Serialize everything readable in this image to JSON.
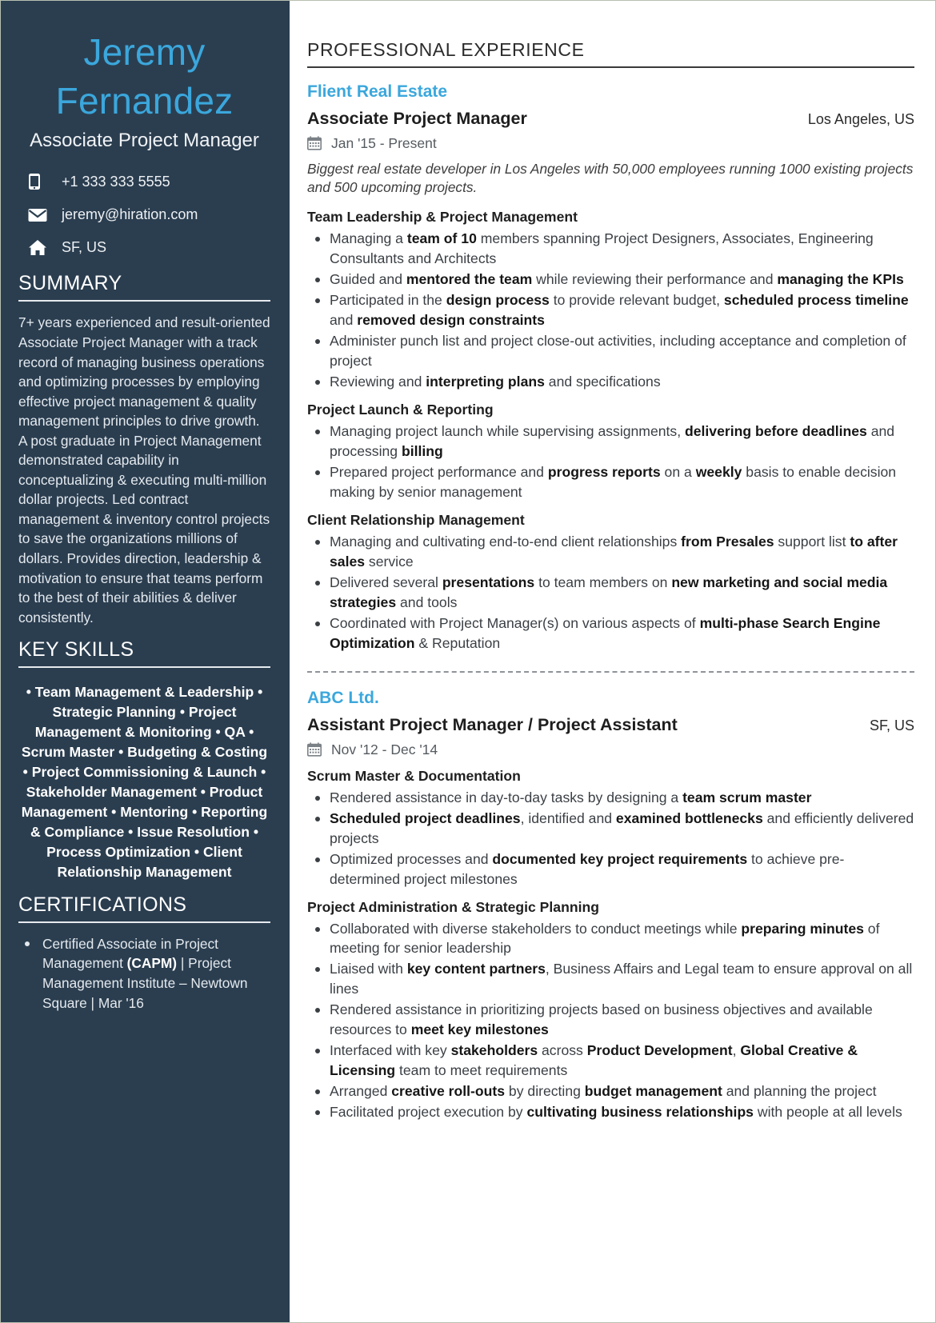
{
  "theme": {
    "sidebar_bg": "#2B3E50",
    "accent": "#3BA7DC",
    "page_bg": "#FFFFFF",
    "body_text": "#3A3F44"
  },
  "sidebar": {
    "name_first": "Jeremy",
    "name_last": "Fernandez",
    "headline": "Associate Project Manager",
    "contacts": [
      {
        "icon": "mobile-phone-icon",
        "value": "+1 333 333 5555"
      },
      {
        "icon": "envelope-icon",
        "value": "jeremy@hiration.com"
      },
      {
        "icon": "home-icon",
        "value": "SF, US"
      }
    ],
    "summary": {
      "title": "SUMMARY",
      "text": "7+ years experienced and result-oriented Associate Project Manager with a track record of managing business operations and optimizing processes by employing effective project management & quality management principles to drive growth. A post graduate in Project Management demonstrated capability in conceptualizing & executing multi-million dollar projects. Led contract management & inventory control projects to save the organizations millions of dollars. Provides direction, leadership & motivation to ensure that teams perform to the best of their abilities & deliver consistently."
    },
    "key_skills": {
      "title": "KEY SKILLS",
      "text": "• Team Management & Leadership • Strategic Planning • Project Management & Monitoring • QA • Scrum Master • Budgeting & Costing • Project Commissioning & Launch • Stakeholder Management • Product Management • Mentoring • Reporting & Compliance • Issue Resolution • Process Optimization • Client Relationship Management"
    },
    "certifications": {
      "title": "CERTIFICATIONS",
      "items": [
        {
          "pre": "Certified Associate in Project Management ",
          "bold": "(CAPM)",
          "post": " | Project Management Institute – Newtown Square | Mar '16"
        }
      ]
    }
  },
  "main": {
    "section_title": "PROFESSIONAL EXPERIENCE",
    "jobs": [
      {
        "company": "Flient Real Estate",
        "role": "Associate Project Manager",
        "location": "Los Angeles, US",
        "date_icon": "calendar-icon",
        "dates": "Jan '15  -  Present",
        "blurb": "Biggest real estate developer in Los Angeles with 50,000 employees running 1000 existing projects and 500 upcoming projects.",
        "groups": [
          {
            "title": "Team Leadership & Project Management",
            "bullets": [
              [
                {
                  "t": "Managing a "
                },
                {
                  "t": "team of 10",
                  "b": true
                },
                {
                  "t": " members spanning Project Designers, Associates, Engineering Consultants and Architects"
                }
              ],
              [
                {
                  "t": "Guided and "
                },
                {
                  "t": "mentored the team",
                  "b": true
                },
                {
                  "t": " while reviewing their performance and "
                },
                {
                  "t": "managing the KPIs",
                  "b": true
                }
              ],
              [
                {
                  "t": "Participated in the "
                },
                {
                  "t": "design process",
                  "b": true
                },
                {
                  "t": " to provide relevant budget, "
                },
                {
                  "t": "scheduled process timeline",
                  "b": true
                },
                {
                  "t": " and "
                },
                {
                  "t": "removed design constraints",
                  "b": true
                }
              ],
              [
                {
                  "t": "Administer punch list and project close-out activities, including acceptance and completion of project"
                }
              ],
              [
                {
                  "t": "Reviewing and "
                },
                {
                  "t": "interpreting plans",
                  "b": true
                },
                {
                  "t": " and specifications"
                }
              ]
            ]
          },
          {
            "title": "Project Launch & Reporting",
            "bullets": [
              [
                {
                  "t": "Managing project launch while supervising assignments, "
                },
                {
                  "t": "delivering before deadlines",
                  "b": true
                },
                {
                  "t": " and processing "
                },
                {
                  "t": "billing",
                  "b": true
                }
              ],
              [
                {
                  "t": "Prepared project performance and "
                },
                {
                  "t": "progress reports",
                  "b": true
                },
                {
                  "t": " on a "
                },
                {
                  "t": "weekly",
                  "b": true
                },
                {
                  "t": " basis to enable decision making by senior management"
                }
              ]
            ]
          },
          {
            "title": "Client Relationship Management",
            "bullets": [
              [
                {
                  "t": "Managing and cultivating end-to-end client relationships "
                },
                {
                  "t": "from Presales",
                  "b": true
                },
                {
                  "t": " support list "
                },
                {
                  "t": "to after sales",
                  "b": true
                },
                {
                  "t": " service"
                }
              ],
              [
                {
                  "t": "Delivered several "
                },
                {
                  "t": "presentations",
                  "b": true
                },
                {
                  "t": " to team members on "
                },
                {
                  "t": "new marketing and social media strategies",
                  "b": true
                },
                {
                  "t": " and tools"
                }
              ],
              [
                {
                  "t": "Coordinated with Project Manager(s) on various aspects of "
                },
                {
                  "t": "multi-phase Search Engine Optimization",
                  "b": true
                },
                {
                  "t": " & Reputation"
                }
              ]
            ]
          }
        ]
      },
      {
        "company": "ABC Ltd.",
        "role": "Assistant Project Manager / Project Assistant",
        "location": "SF, US",
        "date_icon": "calendar-icon",
        "dates": "Nov '12  -  Dec '14",
        "blurb": "",
        "groups": [
          {
            "title": "Scrum Master & Documentation",
            "bullets": [
              [
                {
                  "t": "Rendered assistance in day-to-day tasks by designing a "
                },
                {
                  "t": "team scrum master",
                  "b": true
                }
              ],
              [
                {
                  "t": "Scheduled project deadlines",
                  "b": true
                },
                {
                  "t": ", identified and "
                },
                {
                  "t": "examined bottlenecks",
                  "b": true
                },
                {
                  "t": " and efficiently delivered projects"
                }
              ],
              [
                {
                  "t": "Optimized processes and "
                },
                {
                  "t": "documented key project requirements",
                  "b": true
                },
                {
                  "t": " to achieve pre-determined project milestones"
                }
              ]
            ]
          },
          {
            "title": "Project Administration & Strategic Planning",
            "bullets": [
              [
                {
                  "t": "Collaborated with diverse stakeholders to conduct meetings while "
                },
                {
                  "t": "preparing minutes",
                  "b": true
                },
                {
                  "t": " of meeting for senior leadership"
                }
              ],
              [
                {
                  "t": "Liaised with "
                },
                {
                  "t": "key content partners",
                  "b": true
                },
                {
                  "t": ", Business Affairs and Legal team to ensure approval on all lines"
                }
              ],
              [
                {
                  "t": "Rendered assistance in prioritizing projects based on business objectives and available resources to "
                },
                {
                  "t": "meet key milestones",
                  "b": true
                }
              ],
              [
                {
                  "t": "Interfaced with key "
                },
                {
                  "t": "stakeholders",
                  "b": true
                },
                {
                  "t": " across "
                },
                {
                  "t": "Product Development",
                  "b": true
                },
                {
                  "t": ", "
                },
                {
                  "t": "Global Creative & Licensing",
                  "b": true
                },
                {
                  "t": " team to meet requirements"
                }
              ],
              [
                {
                  "t": "Arranged "
                },
                {
                  "t": "creative roll-outs",
                  "b": true
                },
                {
                  "t": " by directing "
                },
                {
                  "t": "budget management",
                  "b": true
                },
                {
                  "t": " and planning the project"
                }
              ],
              [
                {
                  "t": "Facilitated project execution by "
                },
                {
                  "t": "cultivating business relationships",
                  "b": true
                },
                {
                  "t": " with people at all levels"
                }
              ]
            ]
          }
        ]
      }
    ]
  }
}
